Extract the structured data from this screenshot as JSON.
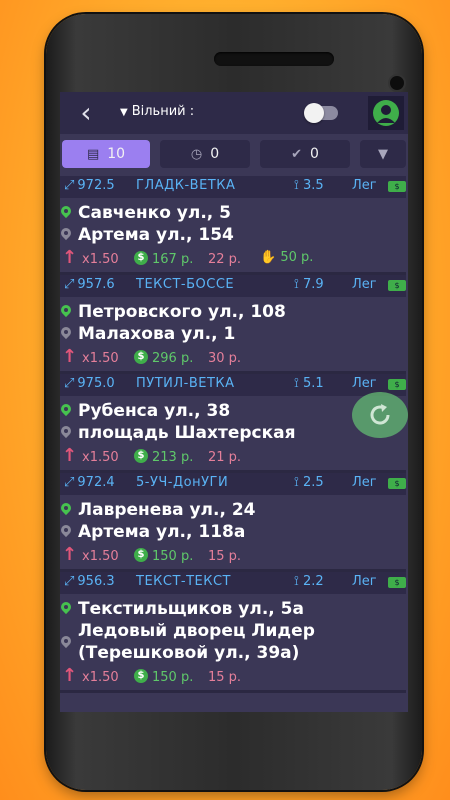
{
  "topbar": {
    "back_icon": "‹",
    "status_label": "Вільний :",
    "toggle_on": false
  },
  "tabs": [
    {
      "icon": "list-icon",
      "glyph": "▤",
      "count": "10",
      "active": true
    },
    {
      "icon": "clock-icon",
      "glyph": "◷",
      "count": "0",
      "active": false
    },
    {
      "icon": "check-icon",
      "glyph": "✔",
      "count": "0",
      "active": false
    },
    {
      "icon": "filter-icon",
      "glyph": "▼",
      "count": "",
      "active": false
    }
  ],
  "orders": [
    {
      "distance": "972.5",
      "zone": "ГЛАДК-ВЕТКА",
      "route_km": "3.5",
      "tariff": "Лег",
      "from": "Савченко ул., 5",
      "to": "Артема ул., 154",
      "multiplier": "x1.50",
      "sum": "167 р.",
      "min_price": "22 р.",
      "bonus": "50 р."
    },
    {
      "distance": "957.6",
      "zone": "ТЕКСТ-БОССЕ",
      "route_km": "7.9",
      "tariff": "Лег",
      "from": "Петровского ул., 108",
      "to": "Малахова ул., 1",
      "multiplier": "x1.50",
      "sum": "296 р.",
      "min_price": "30 р.",
      "bonus": ""
    },
    {
      "distance": "975.0",
      "zone": "ПУТИЛ-ВЕТКА",
      "route_km": "5.1",
      "tariff": "Лег",
      "from": "Рубенса ул., 38",
      "to": "площадь Шахтерская",
      "multiplier": "x1.50",
      "sum": "213 р.",
      "min_price": "21 р.",
      "bonus": ""
    },
    {
      "distance": "972.4",
      "zone": "5-УЧ-ДонУГИ",
      "route_km": "2.5",
      "tariff": "Лег",
      "from": "Лавренева ул., 24",
      "to": "Артема ул., 118а",
      "multiplier": "x1.50",
      "sum": "150 р.",
      "min_price": "15 р.",
      "bonus": ""
    },
    {
      "distance": "956.3",
      "zone": "ТЕКСТ-ТЕКСТ",
      "route_km": "2.2",
      "tariff": "Лег",
      "from": "Текстильщиков ул., 5а",
      "to": "Ледовый дворец Лидер (Терешковой ул., 39а)",
      "multiplier": "x1.50",
      "sum": "150 р.",
      "min_price": "15 р.",
      "bonus": ""
    }
  ],
  "colors": {
    "accent": "#9b7ff0",
    "header_bg": "#2e2a48",
    "list_bg": "#3b3756",
    "link_blue": "#5ab3f5",
    "money_green": "#5fc86a",
    "price_pink": "#e57f9a"
  }
}
